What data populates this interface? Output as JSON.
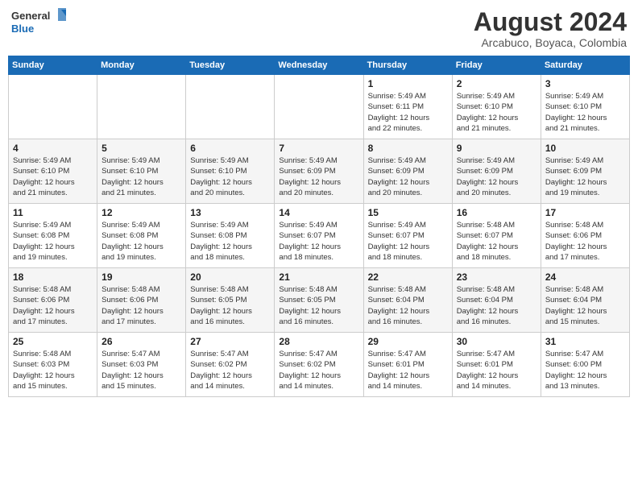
{
  "header": {
    "logo_line1": "General",
    "logo_line2": "Blue",
    "title": "August 2024",
    "subtitle": "Arcabuco, Boyaca, Colombia"
  },
  "weekdays": [
    "Sunday",
    "Monday",
    "Tuesday",
    "Wednesday",
    "Thursday",
    "Friday",
    "Saturday"
  ],
  "weeks": [
    [
      {
        "day": "",
        "info": ""
      },
      {
        "day": "",
        "info": ""
      },
      {
        "day": "",
        "info": ""
      },
      {
        "day": "",
        "info": ""
      },
      {
        "day": "1",
        "info": "Sunrise: 5:49 AM\nSunset: 6:11 PM\nDaylight: 12 hours\nand 22 minutes."
      },
      {
        "day": "2",
        "info": "Sunrise: 5:49 AM\nSunset: 6:10 PM\nDaylight: 12 hours\nand 21 minutes."
      },
      {
        "day": "3",
        "info": "Sunrise: 5:49 AM\nSunset: 6:10 PM\nDaylight: 12 hours\nand 21 minutes."
      }
    ],
    [
      {
        "day": "4",
        "info": "Sunrise: 5:49 AM\nSunset: 6:10 PM\nDaylight: 12 hours\nand 21 minutes."
      },
      {
        "day": "5",
        "info": "Sunrise: 5:49 AM\nSunset: 6:10 PM\nDaylight: 12 hours\nand 21 minutes."
      },
      {
        "day": "6",
        "info": "Sunrise: 5:49 AM\nSunset: 6:10 PM\nDaylight: 12 hours\nand 20 minutes."
      },
      {
        "day": "7",
        "info": "Sunrise: 5:49 AM\nSunset: 6:09 PM\nDaylight: 12 hours\nand 20 minutes."
      },
      {
        "day": "8",
        "info": "Sunrise: 5:49 AM\nSunset: 6:09 PM\nDaylight: 12 hours\nand 20 minutes."
      },
      {
        "day": "9",
        "info": "Sunrise: 5:49 AM\nSunset: 6:09 PM\nDaylight: 12 hours\nand 20 minutes."
      },
      {
        "day": "10",
        "info": "Sunrise: 5:49 AM\nSunset: 6:09 PM\nDaylight: 12 hours\nand 19 minutes."
      }
    ],
    [
      {
        "day": "11",
        "info": "Sunrise: 5:49 AM\nSunset: 6:08 PM\nDaylight: 12 hours\nand 19 minutes."
      },
      {
        "day": "12",
        "info": "Sunrise: 5:49 AM\nSunset: 6:08 PM\nDaylight: 12 hours\nand 19 minutes."
      },
      {
        "day": "13",
        "info": "Sunrise: 5:49 AM\nSunset: 6:08 PM\nDaylight: 12 hours\nand 18 minutes."
      },
      {
        "day": "14",
        "info": "Sunrise: 5:49 AM\nSunset: 6:07 PM\nDaylight: 12 hours\nand 18 minutes."
      },
      {
        "day": "15",
        "info": "Sunrise: 5:49 AM\nSunset: 6:07 PM\nDaylight: 12 hours\nand 18 minutes."
      },
      {
        "day": "16",
        "info": "Sunrise: 5:48 AM\nSunset: 6:07 PM\nDaylight: 12 hours\nand 18 minutes."
      },
      {
        "day": "17",
        "info": "Sunrise: 5:48 AM\nSunset: 6:06 PM\nDaylight: 12 hours\nand 17 minutes."
      }
    ],
    [
      {
        "day": "18",
        "info": "Sunrise: 5:48 AM\nSunset: 6:06 PM\nDaylight: 12 hours\nand 17 minutes."
      },
      {
        "day": "19",
        "info": "Sunrise: 5:48 AM\nSunset: 6:06 PM\nDaylight: 12 hours\nand 17 minutes."
      },
      {
        "day": "20",
        "info": "Sunrise: 5:48 AM\nSunset: 6:05 PM\nDaylight: 12 hours\nand 16 minutes."
      },
      {
        "day": "21",
        "info": "Sunrise: 5:48 AM\nSunset: 6:05 PM\nDaylight: 12 hours\nand 16 minutes."
      },
      {
        "day": "22",
        "info": "Sunrise: 5:48 AM\nSunset: 6:04 PM\nDaylight: 12 hours\nand 16 minutes."
      },
      {
        "day": "23",
        "info": "Sunrise: 5:48 AM\nSunset: 6:04 PM\nDaylight: 12 hours\nand 16 minutes."
      },
      {
        "day": "24",
        "info": "Sunrise: 5:48 AM\nSunset: 6:04 PM\nDaylight: 12 hours\nand 15 minutes."
      }
    ],
    [
      {
        "day": "25",
        "info": "Sunrise: 5:48 AM\nSunset: 6:03 PM\nDaylight: 12 hours\nand 15 minutes."
      },
      {
        "day": "26",
        "info": "Sunrise: 5:47 AM\nSunset: 6:03 PM\nDaylight: 12 hours\nand 15 minutes."
      },
      {
        "day": "27",
        "info": "Sunrise: 5:47 AM\nSunset: 6:02 PM\nDaylight: 12 hours\nand 14 minutes."
      },
      {
        "day": "28",
        "info": "Sunrise: 5:47 AM\nSunset: 6:02 PM\nDaylight: 12 hours\nand 14 minutes."
      },
      {
        "day": "29",
        "info": "Sunrise: 5:47 AM\nSunset: 6:01 PM\nDaylight: 12 hours\nand 14 minutes."
      },
      {
        "day": "30",
        "info": "Sunrise: 5:47 AM\nSunset: 6:01 PM\nDaylight: 12 hours\nand 14 minutes."
      },
      {
        "day": "31",
        "info": "Sunrise: 5:47 AM\nSunset: 6:00 PM\nDaylight: 12 hours\nand 13 minutes."
      }
    ]
  ]
}
